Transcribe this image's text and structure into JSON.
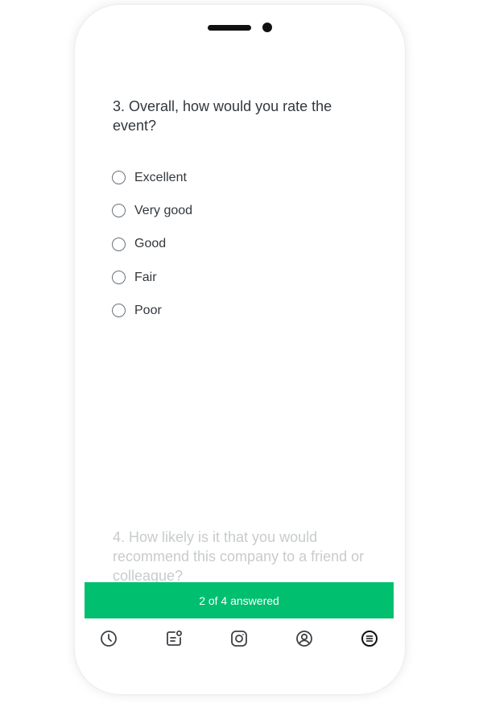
{
  "survey": {
    "question": "3. Overall, how would you rate the event?",
    "options": [
      "Excellent",
      "Very good",
      "Good",
      "Fair",
      "Poor"
    ],
    "next_question": "4. How likely is it that you would recommend this company to a friend or colleague?",
    "progress_label": "2 of 4 answered",
    "accent_color": "#00bf6f"
  },
  "nav": {
    "icons": [
      "clock-icon",
      "note-notification-icon",
      "camera-icon",
      "profile-icon",
      "menu-icon"
    ],
    "active": "menu-icon"
  }
}
